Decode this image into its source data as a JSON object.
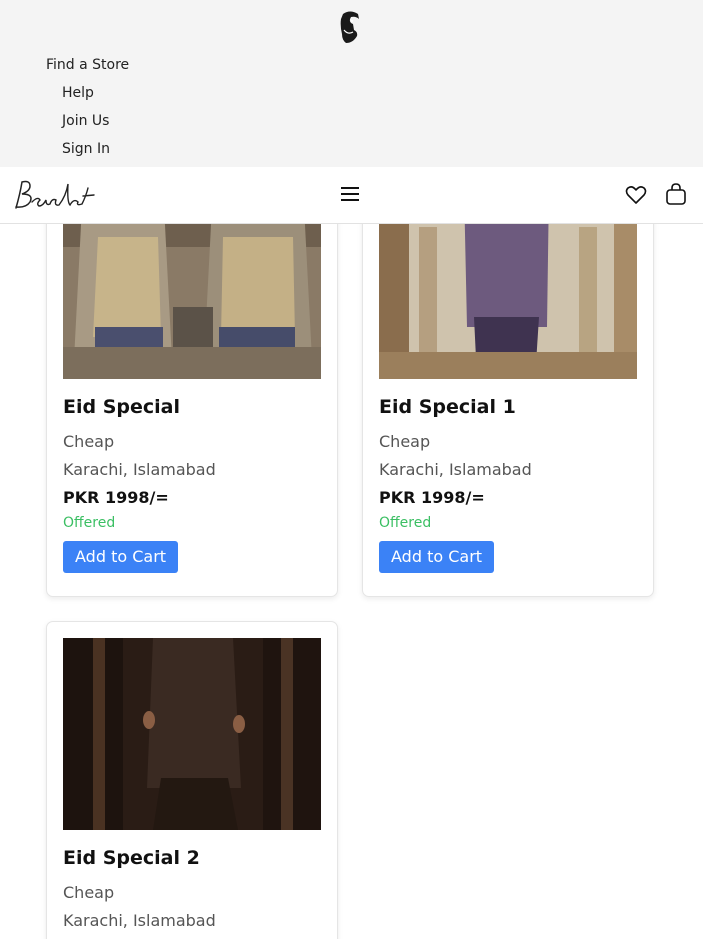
{
  "header": {
    "top_links": [
      "Find a Store",
      "Help",
      "Join Us",
      "Sign In"
    ]
  },
  "navbar": {
    "logo_text": "Bendat"
  },
  "products": [
    {
      "title": "Eid Special",
      "tag": "Cheap",
      "locations": "Karachi, Islamabad",
      "price": "PKR 1998/=",
      "status": "Offered",
      "button": "Add to Cart"
    },
    {
      "title": "Eid Special 1",
      "tag": "Cheap",
      "locations": "Karachi, Islamabad",
      "price": "PKR 1998/=",
      "status": "Offered",
      "button": "Add to Cart"
    },
    {
      "title": "Eid Special 2",
      "tag": "Cheap",
      "locations": "Karachi, Islamabad"
    }
  ],
  "colors": {
    "accent": "#3b82f6",
    "status_green": "#3bbf63",
    "topbar_bg": "#f4f4f4"
  },
  "icons": [
    "brand-face-icon",
    "menu-icon",
    "heart-icon",
    "shopping-bag-icon"
  ]
}
